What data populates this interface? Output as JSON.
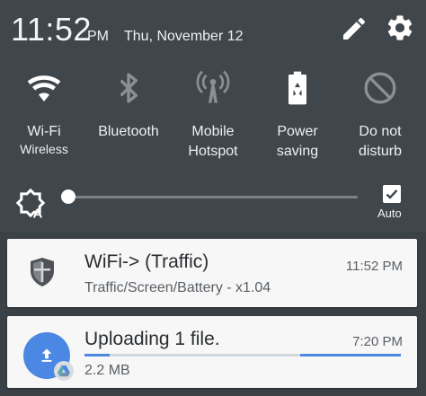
{
  "status": {
    "time": "11:52",
    "ampm": "PM",
    "date": "Thu, November 12"
  },
  "quick_settings": [
    {
      "label": "Wi-Fi",
      "sub": "Wireless",
      "icon": "wifi-icon",
      "active": true
    },
    {
      "label": "Bluetooth",
      "sub": "",
      "icon": "bluetooth-icon",
      "active": false
    },
    {
      "label": "Mobile",
      "label2": "Hotspot",
      "icon": "hotspot-icon",
      "active": false
    },
    {
      "label": "Power",
      "label2": "saving",
      "icon": "power-saving-icon",
      "active": true
    },
    {
      "label": "Do not",
      "label2": "disturb",
      "icon": "do-not-disturb-icon",
      "active": false
    }
  ],
  "brightness": {
    "level": 0.02,
    "auto_label": "Auto",
    "auto_checked": true
  },
  "notifications": [
    {
      "title": "WiFi-> (Traffic)",
      "subtitle": "Traffic/Screen/Battery - x1.04",
      "time": "11:52 PM",
      "icon": "shield-icon"
    },
    {
      "title": "Uploading 1 file.",
      "subtitle": "2.2 MB",
      "time": "7:20 PM",
      "icon": "upload-icon",
      "progress": 0.08
    }
  ],
  "colors": {
    "shade": "#3f464c",
    "accent": "#4b88e3",
    "card": "#f7f7f7"
  }
}
